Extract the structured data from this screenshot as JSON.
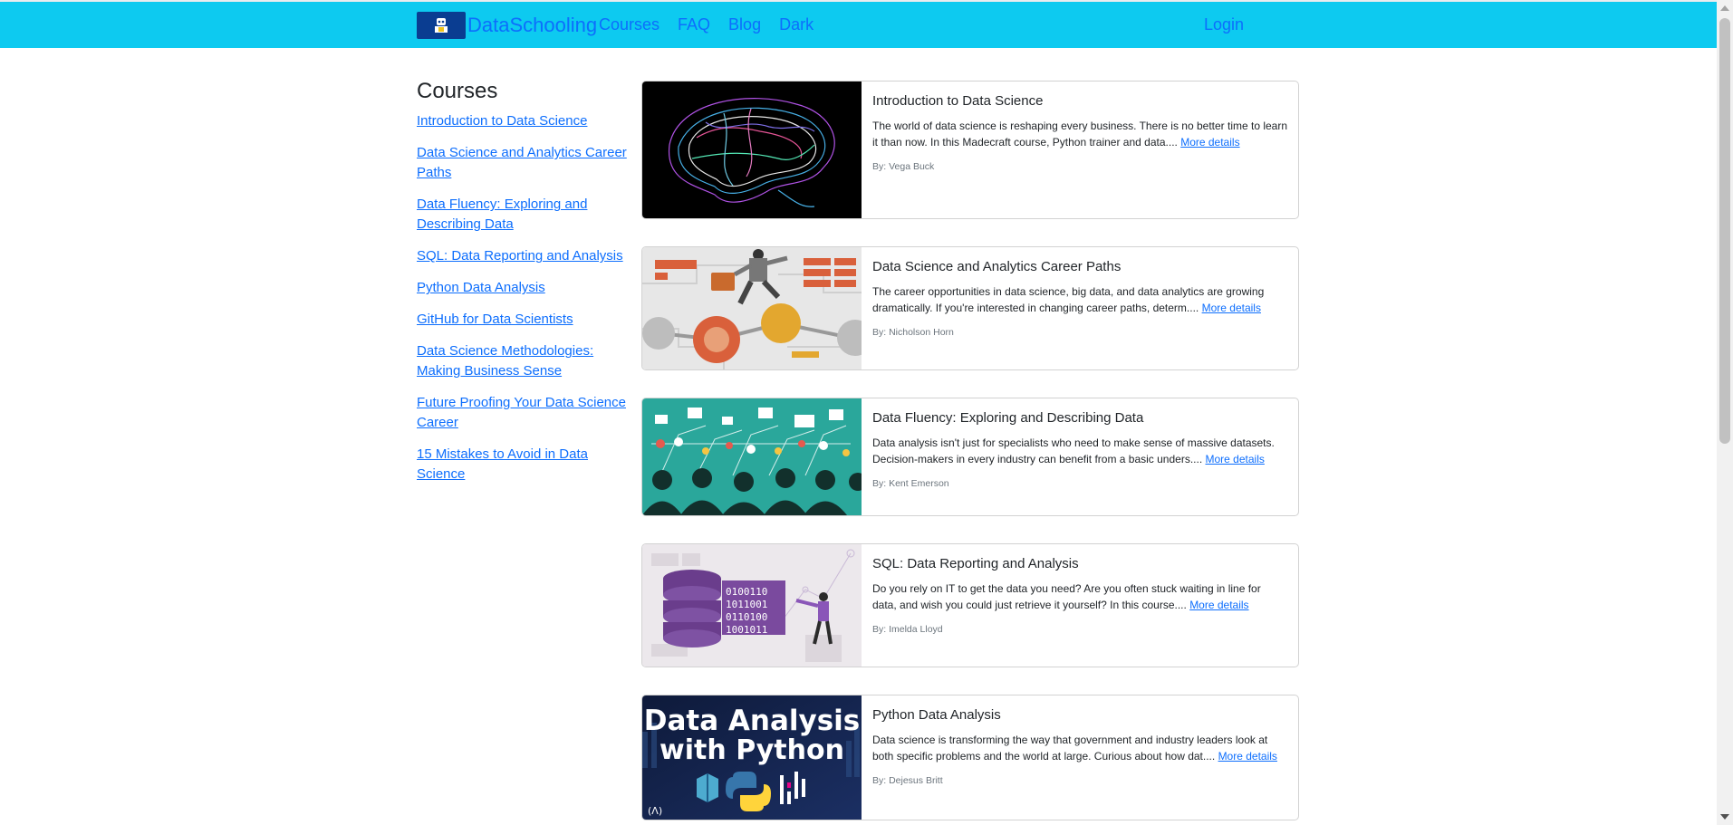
{
  "navbar": {
    "brand": "DataSchooling",
    "brand_icon": "robot-reading-icon",
    "links": [
      "Courses",
      "FAQ",
      "Blog",
      "Dark"
    ],
    "login": "Login",
    "colors": {
      "background": "#0dcaf0",
      "link": "#0d6efd",
      "logo_bg": "#0a3d91"
    }
  },
  "sidebar": {
    "heading": "Courses",
    "items": [
      "Introduction to Data Science",
      "Data Science and Analytics Career Paths",
      "Data Fluency: Exploring and Describing Data",
      "SQL: Data Reporting and Analysis",
      "Python Data Analysis",
      "GitHub for Data Scientists",
      "Data Science Methodologies: Making Business Sense",
      "Future Proofing Your Data Science Career",
      "15 Mistakes to Avoid in Data Science"
    ]
  },
  "cards": [
    {
      "title": "Introduction to Data Science",
      "text": "The world of data science is reshaping every business. There is no better time to learn it than now. In this Madecraft course, Python trainer and data....",
      "more": "More details",
      "author": "By: Vega Buck",
      "image": "neon-brain-image"
    },
    {
      "title": "Data Science and Analytics Career Paths",
      "text": "The career opportunities in data science, big data, and data analytics are growing dramatically. If you're interested in changing career paths, determ....",
      "more": "More details",
      "author": "By: Nicholson Horn",
      "image": "career-path-illustration"
    },
    {
      "title": "Data Fluency: Exploring and Describing Data",
      "text": "Data analysis isn't just for specialists who need to make sense of massive datasets. Decision-makers in every industry can benefit from a basic unders....",
      "more": "More details",
      "author": "By: Kent Emerson",
      "image": "data-crowd-illustration"
    },
    {
      "title": "SQL: Data Reporting and Analysis",
      "text": "Do you rely on IT to get the data you need? Are you often stuck waiting in line for data, and wish you could just retrieve it yourself? In this course....",
      "more": "More details",
      "author": "By: Imelda Lloyd",
      "image": "database-illustration"
    },
    {
      "title": "Python Data Analysis",
      "text": "Data science is transforming the way that government and industry leaders look at both specific problems and the world at large. Curious about how dat....",
      "more": "More details",
      "author": "By: Dejesus Britt",
      "image": "python-thumbnail",
      "image_text": {
        "line1": "Data Analysis",
        "line2": "with Python"
      }
    }
  ]
}
